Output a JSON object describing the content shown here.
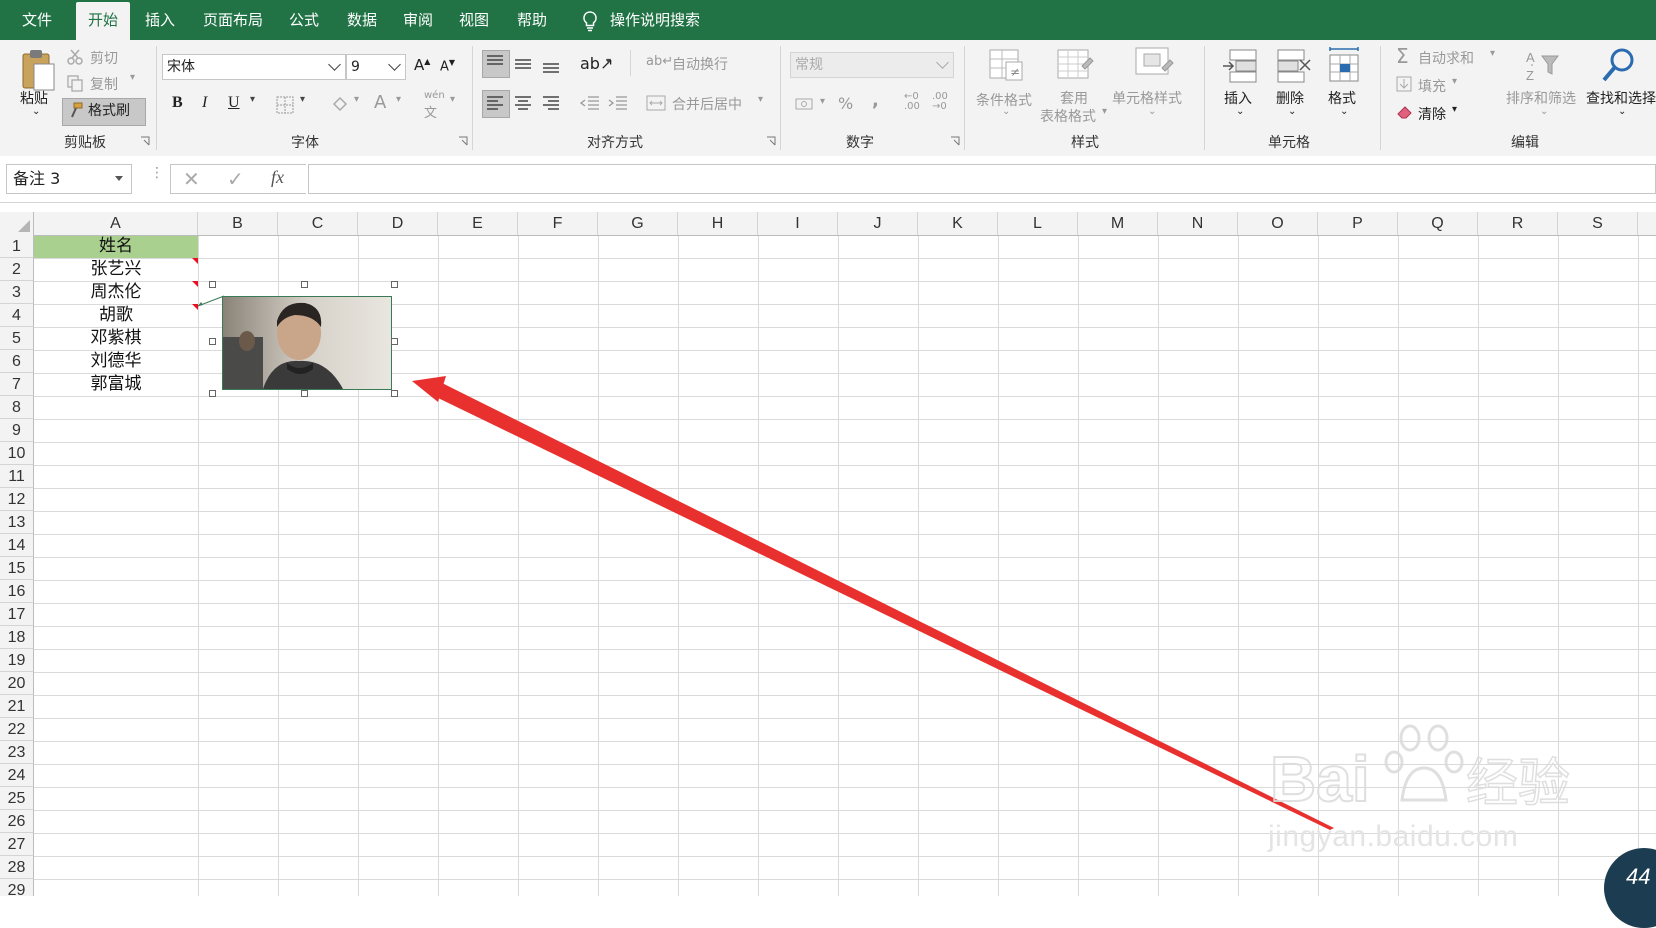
{
  "tabs": [
    {
      "label": "文件",
      "active": false
    },
    {
      "label": "开始",
      "active": true
    },
    {
      "label": "插入",
      "active": false
    },
    {
      "label": "页面布局",
      "active": false
    },
    {
      "label": "公式",
      "active": false
    },
    {
      "label": "数据",
      "active": false
    },
    {
      "label": "审阅",
      "active": false
    },
    {
      "label": "视图",
      "active": false
    },
    {
      "label": "帮助",
      "active": false
    }
  ],
  "tell_me": "操作说明搜索",
  "ribbon": {
    "clipboard": {
      "group": "剪贴板",
      "paste": "粘贴",
      "cut": "剪切",
      "copy": "复制",
      "format_painter": "格式刷"
    },
    "font": {
      "group": "字体",
      "font_name": "宋体",
      "font_size": "9",
      "bold": "B",
      "italic": "I",
      "underline": "U",
      "font_color": "A",
      "pinyin": "wén"
    },
    "alignment": {
      "group": "对齐方式",
      "wrap_text": "自动换行",
      "merge_center": "合并后居中"
    },
    "number": {
      "group": "数字",
      "format": "常规",
      "percent": "%",
      "comma": ","
    },
    "styles": {
      "group": "样式",
      "conditional": "条件格式",
      "table_format_1": "套用",
      "table_format_2": "表格格式",
      "cell_styles": "单元格样式"
    },
    "cells": {
      "group": "单元格",
      "insert": "插入",
      "delete": "删除",
      "format": "格式"
    },
    "editing": {
      "group": "编辑",
      "autosum": "自动求和",
      "fill": "填充",
      "clear": "清除",
      "sort_filter": "排序和筛选",
      "find_select": "查找和选择"
    }
  },
  "formula_bar": {
    "name_box": "备注 3",
    "fx": "fx",
    "formula": ""
  },
  "columns": [
    "A",
    "B",
    "C",
    "D",
    "E",
    "F",
    "G",
    "H",
    "I",
    "J",
    "K",
    "L",
    "M",
    "N",
    "O",
    "P",
    "Q",
    "R",
    "S"
  ],
  "rows": [
    "1",
    "2",
    "3",
    "4",
    "5",
    "6",
    "7",
    "8",
    "9",
    "10",
    "11",
    "12",
    "13",
    "14",
    "15",
    "16",
    "17",
    "18",
    "19",
    "20",
    "21",
    "22",
    "23",
    "24",
    "25",
    "26",
    "27",
    "28",
    "29"
  ],
  "cells_A": [
    "姓名",
    "张艺兴",
    "周杰伦",
    "胡歌",
    "邓紫棋",
    "刘德华",
    "郭富城"
  ],
  "colors": {
    "accent": "#217346",
    "header_fill": "#a9d08e",
    "arrow": "#e8312f",
    "comment": "#e81123"
  },
  "watermark": {
    "logo": "Bai du 经验",
    "url": "jingyan.baidu.com"
  }
}
